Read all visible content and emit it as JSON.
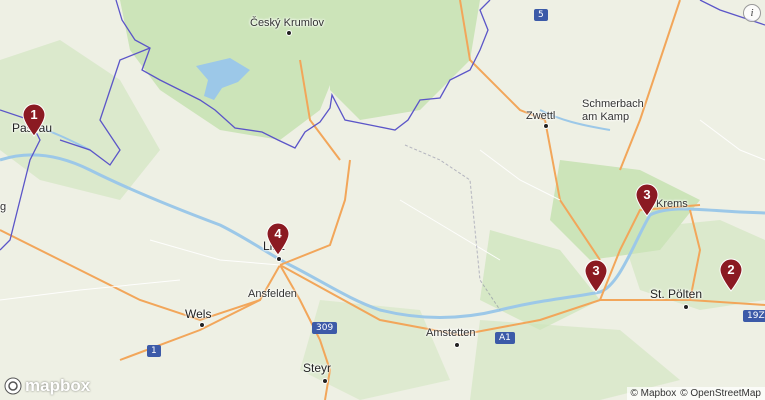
{
  "map": {
    "places": [
      {
        "id": "cesky-krumlov",
        "label": "Český Krumlov"
      },
      {
        "id": "passau",
        "label": "Passau"
      },
      {
        "id": "zwettl",
        "label": "Zwettl"
      },
      {
        "id": "schmerbach",
        "label": "Schmerbach\nam Kamp"
      },
      {
        "id": "krems",
        "label": "Krems"
      },
      {
        "id": "linz",
        "label": "Linz"
      },
      {
        "id": "ansfelden",
        "label": "Ansfelden"
      },
      {
        "id": "wels",
        "label": "Wels"
      },
      {
        "id": "amstetten",
        "label": "Amstetten"
      },
      {
        "id": "st-polten",
        "label": "St. Pölten"
      },
      {
        "id": "steyr",
        "label": "Steyr"
      },
      {
        "id": "edge-g",
        "label": "g"
      }
    ],
    "road_shields": [
      {
        "id": "5",
        "label": "5"
      },
      {
        "id": "309",
        "label": "309"
      },
      {
        "id": "1",
        "label": "1"
      },
      {
        "id": "a1",
        "label": "A1"
      },
      {
        "id": "19z",
        "label": "19Z"
      }
    ],
    "markers": [
      {
        "id": "passau",
        "count": "1"
      },
      {
        "id": "linz",
        "count": "4"
      },
      {
        "id": "krems",
        "count": "3"
      },
      {
        "id": "melk",
        "count": "3"
      },
      {
        "id": "east",
        "count": "2"
      }
    ],
    "marker_color": "#8b1a22",
    "road_color": "#f2a65a",
    "water_color": "#9cc8e8",
    "forest_color": "#c8e2b4",
    "border_color": "#5b55c8",
    "logo_text": "mapbox",
    "attribution": {
      "mapbox": "© Mapbox",
      "osm": "© OpenStreetMap"
    },
    "info_icon": "info-icon"
  }
}
